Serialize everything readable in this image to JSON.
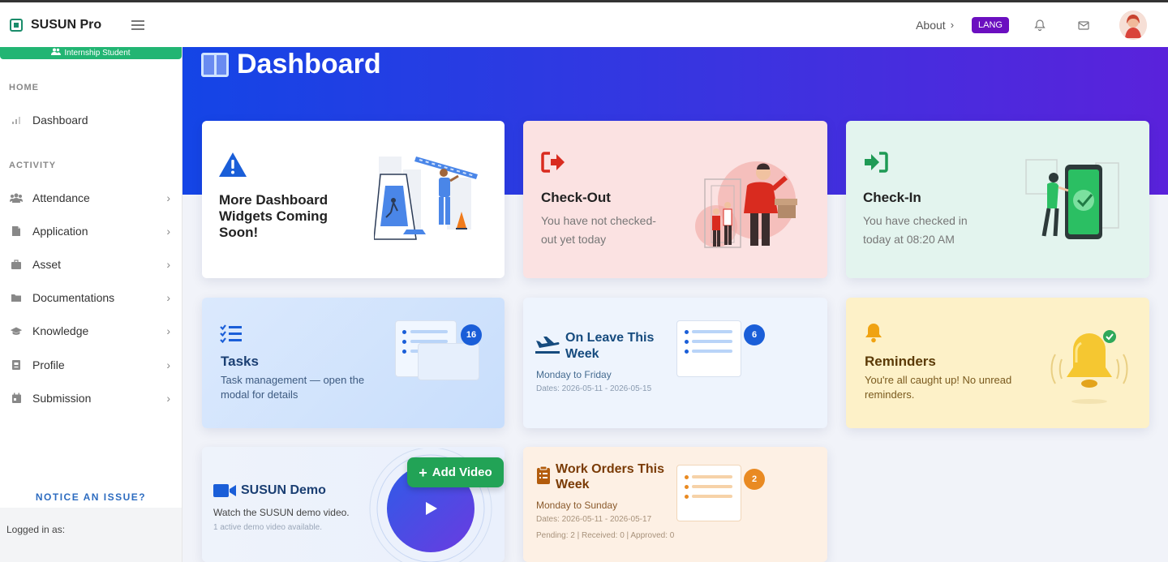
{
  "app": {
    "name": "SUSUN Pro"
  },
  "topbar": {
    "about_label": "About",
    "lang_label": "LANG"
  },
  "sidebar": {
    "role_badge": "Internship Student",
    "home_title": "HOME",
    "activity_title": "ACTIVITY",
    "home_items": [
      {
        "label": "Dashboard",
        "icon": "bar-chart-icon"
      }
    ],
    "activity_items": [
      {
        "label": "Attendance",
        "icon": "users-icon"
      },
      {
        "label": "Application",
        "icon": "file-icon"
      },
      {
        "label": "Asset",
        "icon": "briefcase-icon"
      },
      {
        "label": "Documentations",
        "icon": "folder-icon"
      },
      {
        "label": "Knowledge",
        "icon": "graduation-cap-icon"
      },
      {
        "label": "Profile",
        "icon": "id-card-icon"
      },
      {
        "label": "Submission",
        "icon": "calendar-icon"
      }
    ],
    "notice_label": "NOTICE AN ISSUE?",
    "logged_in_label": "Logged in as:"
  },
  "page": {
    "title": "Dashboard"
  },
  "cards": {
    "coming_soon": {
      "title": "More Dashboard Widgets Coming Soon!"
    },
    "checkout": {
      "title": "Check-Out",
      "text": "You have not checked-out yet today",
      "accent": "#d92b1f"
    },
    "checkin": {
      "title": "Check-In",
      "text": "You have checked in today at 08:20 AM",
      "accent": "#1f9a55"
    },
    "tasks": {
      "title": "Tasks",
      "text": "Task management — open the modal for details",
      "count": "16"
    },
    "leave": {
      "title": "On Leave This Week",
      "range": "Monday to Friday",
      "dates": "Dates: 2026-05-11 - 2026-05-15",
      "count": "6"
    },
    "reminders": {
      "title": "Reminders",
      "text": "You're all caught up! No unread reminders."
    },
    "demo": {
      "title": "SUSUN Demo",
      "text": "Watch the SUSUN demo video.",
      "sub": "1 active demo video available.",
      "add_label": "Add Video"
    },
    "work_orders": {
      "title": "Work Orders This Week",
      "range": "Monday to Sunday",
      "dates": "Dates: 2026-05-11 - 2026-05-17",
      "stats": "Pending: 2 | Received: 0 | Approved: 0",
      "count": "2"
    }
  }
}
